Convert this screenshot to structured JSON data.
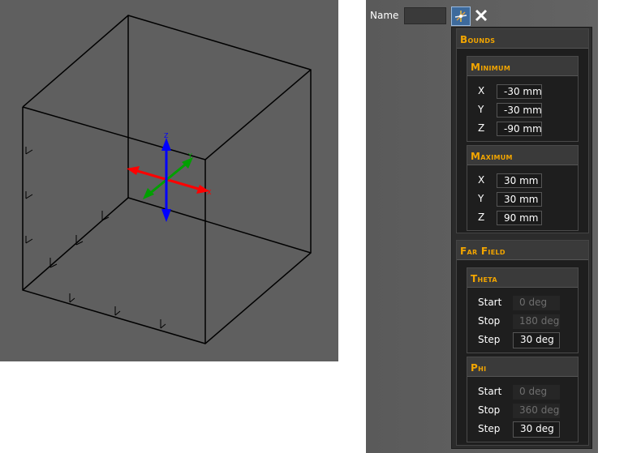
{
  "viewport": {
    "gizmo_axes": {
      "x": "X",
      "y": "Y",
      "z": "Z"
    },
    "colors": {
      "background": "#5f5f5f",
      "x_axis": "#ff0000",
      "y_axis": "#00a000",
      "z_axis": "#0000ff",
      "box": "#000000"
    }
  },
  "toolbar": {
    "name_label": "Name",
    "name_value": "",
    "transform_icon": "transform-icon",
    "close_icon": "close-icon"
  },
  "bounds": {
    "title": "Bounds",
    "minimum": {
      "title": "Minimum",
      "x_label": "X",
      "x_value": "-30 mm",
      "y_label": "Y",
      "y_value": "-30 mm",
      "z_label": "Z",
      "z_value": "-90 mm"
    },
    "maximum": {
      "title": "Maximum",
      "x_label": "X",
      "x_value": "30 mm",
      "y_label": "Y",
      "y_value": "30 mm",
      "z_label": "Z",
      "z_value": "90 mm"
    }
  },
  "far_field": {
    "title": "Far Field",
    "theta": {
      "title": "Theta",
      "start_label": "Start",
      "start_value": "0 deg",
      "stop_label": "Stop",
      "stop_value": "180 deg",
      "step_label": "Step",
      "step_value": "30 deg"
    },
    "phi": {
      "title": "Phi",
      "start_label": "Start",
      "start_value": "0 deg",
      "stop_label": "Stop",
      "stop_value": "360 deg",
      "step_label": "Step",
      "step_value": "30 deg"
    }
  },
  "accent_color": "#f2a500"
}
